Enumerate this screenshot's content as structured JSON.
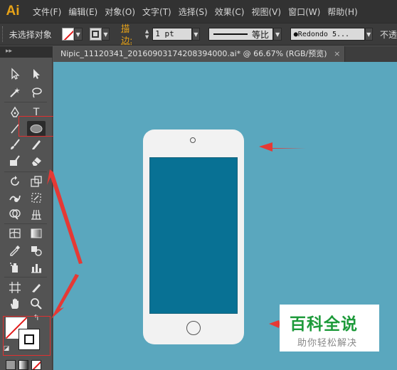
{
  "app": {
    "logo_text": "Ai"
  },
  "menu": [
    "文件(F)",
    "编辑(E)",
    "对象(O)",
    "文字(T)",
    "选择(S)",
    "效果(C)",
    "视图(V)",
    "窗口(W)",
    "帮助(H)"
  ],
  "control": {
    "selection_status": "未选择对象",
    "stroke_label": "描边:",
    "stroke_weight": "1 pt",
    "stroke_profile": "等比",
    "brush_name": "Redondo 5...",
    "opacity_label": "不透"
  },
  "document": {
    "tab_title": "Nipic_11120341_20160903174208394000.ai* @ 66.67% (RGB/预览)",
    "tab_close": "×"
  },
  "tools": {
    "panel_grip": "▸▸",
    "text_tool_glyph": "T",
    "selected_tool": "ellipse-tool"
  },
  "canvas_colors": {
    "background": "#5aa7be",
    "phone_body": "#f2f2f2",
    "phone_screen": "#087194",
    "annotation_arrows": "#e53935"
  },
  "watermark": {
    "title": "百科全说",
    "subtitle": "助你轻松解决"
  }
}
